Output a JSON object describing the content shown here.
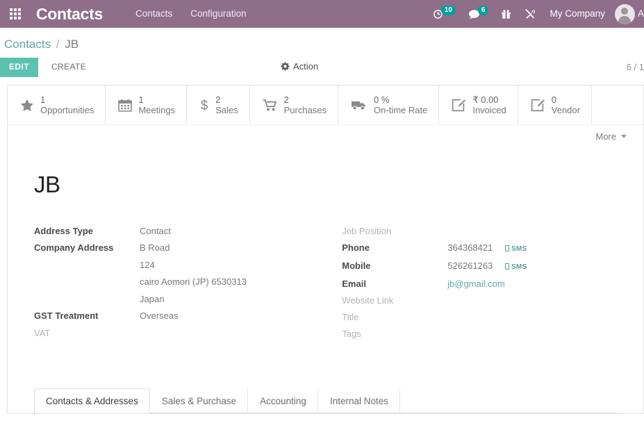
{
  "navbar": {
    "apps_icon": "apps-grid-icon",
    "brand": "Contacts",
    "menu": [
      {
        "label": "Contacts"
      },
      {
        "label": "Configuration"
      }
    ],
    "activity_icon": "clock-icon",
    "activity_count": "10",
    "messages_icon": "chat-bubble-icon",
    "messages_count": "6",
    "gift_icon": "gift-icon",
    "tools_icon": "tools-icon",
    "company": "My Company",
    "avatar_icon": "user-avatar-icon",
    "user_initial": "A",
    "background_color": "#8f6e8a",
    "badge_color": "#00a09d"
  },
  "breadcrumb": {
    "root": "Contacts",
    "separator": "/",
    "current": "JB"
  },
  "control_panel": {
    "edit_label": "EDIT",
    "create_label": "CREATE",
    "action_icon": "gear-icon",
    "action_label": "Action",
    "pager": "6 / 1",
    "edit_button_color": "#5bc2b2"
  },
  "stat_buttons": [
    {
      "icon": "star-icon",
      "value": "1",
      "label": "Opportunities"
    },
    {
      "icon": "calendar-icon",
      "value": "1",
      "label": "Meetings"
    },
    {
      "icon": "dollar-icon",
      "value": "2",
      "label": "Sales"
    },
    {
      "icon": "shopping-cart-icon",
      "value": "2",
      "label": "Purchases"
    },
    {
      "icon": "truck-icon",
      "value": "0 %",
      "label": "On-time Rate"
    },
    {
      "icon": "pencil-square-icon",
      "value": "₹ 0.00",
      "label": "Invoiced"
    },
    {
      "icon": "pencil-square-icon",
      "value": "0",
      "label": "Vendor"
    }
  ],
  "more_dropdown": {
    "label": "More",
    "icon": "chevron-down-icon"
  },
  "record": {
    "title": "JB",
    "left_fields": [
      {
        "label": "Address Type",
        "value": "Contact",
        "empty": false
      },
      {
        "label": "Company Address",
        "value": "B Road",
        "empty": false
      },
      {
        "label": "",
        "value": "124",
        "empty": false
      },
      {
        "label": "",
        "value": "cairo  Aomori (JP)  6530313",
        "empty": false
      },
      {
        "label": "",
        "value": "Japan",
        "empty": false
      },
      {
        "label": "GST Treatment",
        "value": "Overseas",
        "empty": false
      },
      {
        "label": "VAT",
        "value": "",
        "empty": true
      }
    ],
    "right_fields": [
      {
        "label": "Job Position",
        "value": "",
        "empty": true,
        "link": false,
        "sms": false
      },
      {
        "label": "Phone",
        "value": "364368421",
        "empty": false,
        "link": true,
        "sms": true
      },
      {
        "label": "Mobile",
        "value": "526261263",
        "empty": false,
        "link": true,
        "sms": true
      },
      {
        "label": "Email",
        "value": "jb@gmail.com",
        "empty": false,
        "link": true,
        "sms": false
      },
      {
        "label": "Website Link",
        "value": "",
        "empty": true,
        "link": false,
        "sms": false
      },
      {
        "label": "Title",
        "value": "",
        "empty": true,
        "link": false,
        "sms": false
      },
      {
        "label": "Tags",
        "value": "",
        "empty": true,
        "link": false,
        "sms": false
      }
    ],
    "sms_label": "SMS",
    "sms_icon": "mobile-phone-icon"
  },
  "notebook": {
    "tabs": [
      {
        "label": "Contacts & Addresses",
        "active": true
      },
      {
        "label": "Sales & Purchase",
        "active": false
      },
      {
        "label": "Accounting",
        "active": false
      },
      {
        "label": "Internal Notes",
        "active": false
      }
    ]
  }
}
